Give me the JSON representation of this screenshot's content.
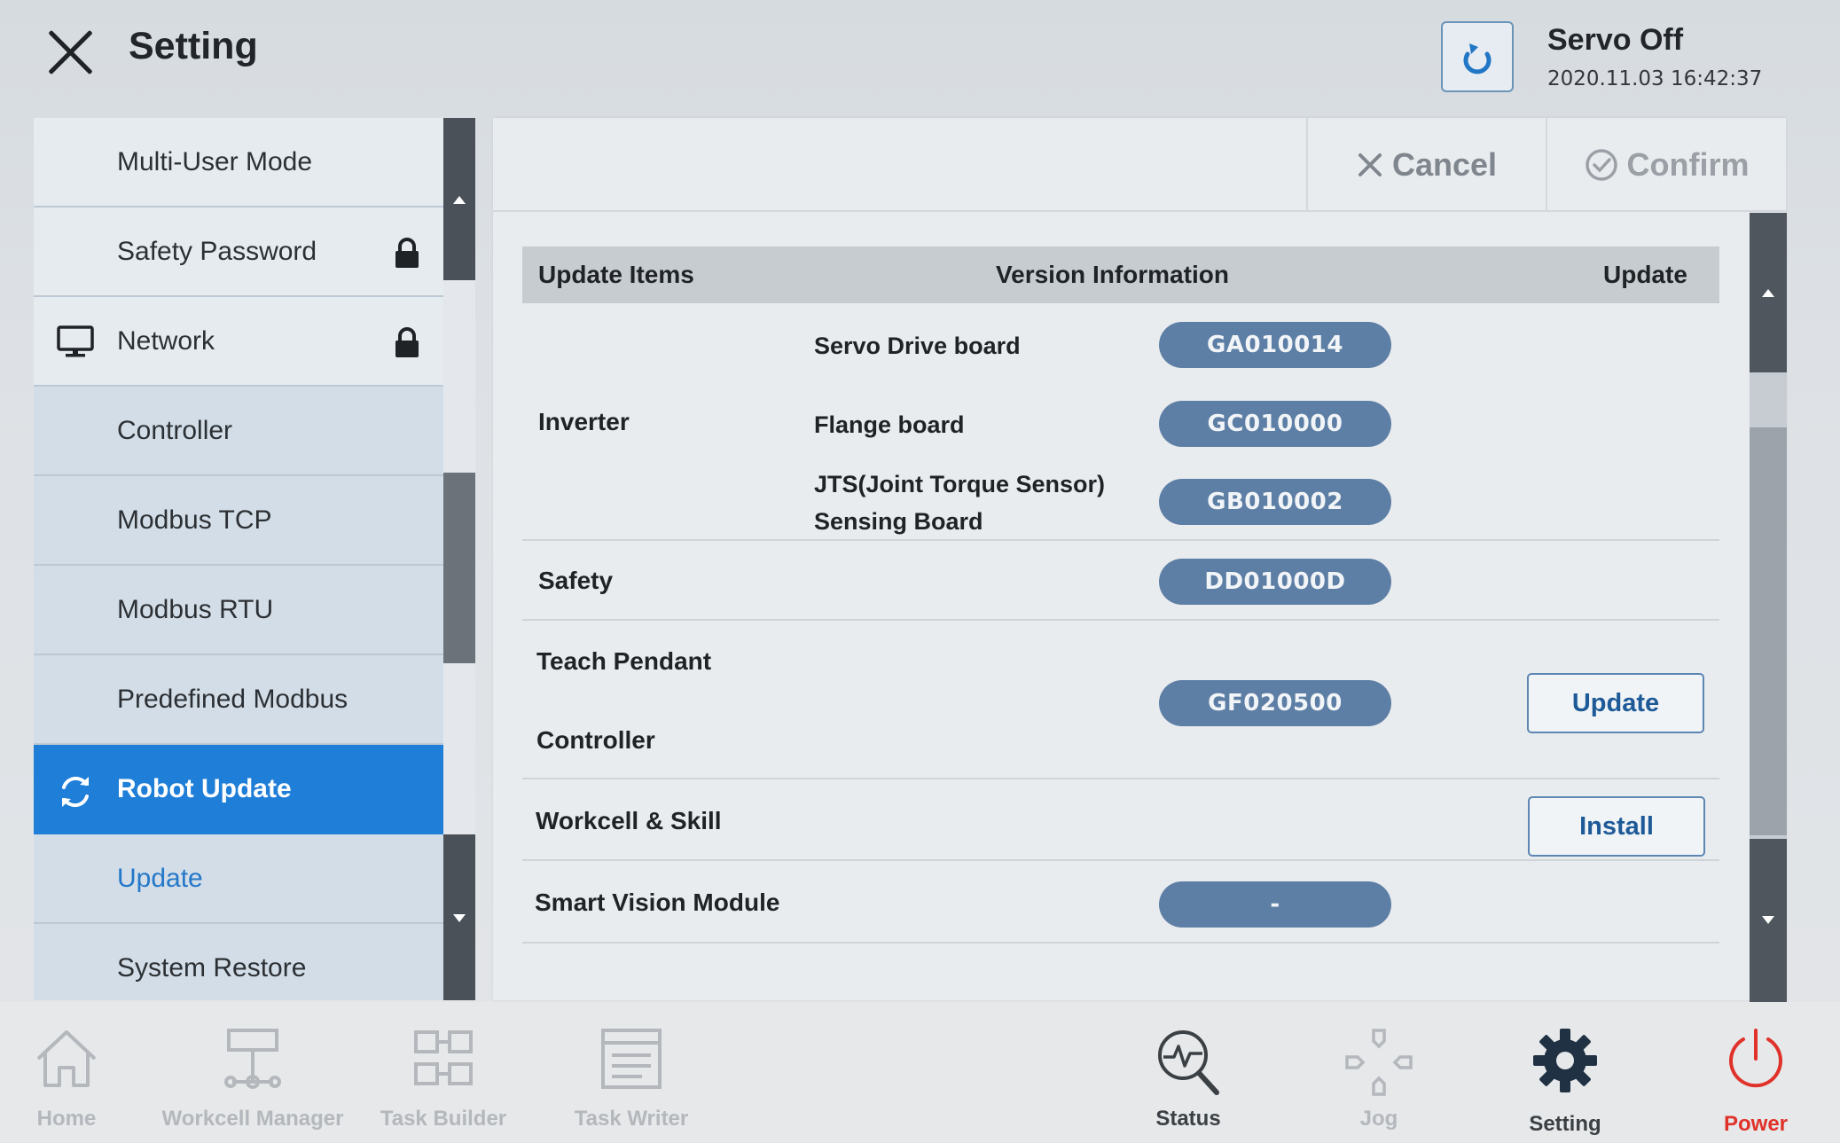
{
  "header": {
    "title": "Setting",
    "servo_state": "Servo Off",
    "datetime": "2020.11.03 16:42:37"
  },
  "sidebar": {
    "items": [
      {
        "label": "Multi-User Mode",
        "locked": false
      },
      {
        "label": "Safety Password",
        "locked": true
      },
      {
        "label": "Network",
        "locked": true,
        "icon": "monitor-icon"
      },
      {
        "label": "Controller"
      },
      {
        "label": "Modbus TCP"
      },
      {
        "label": "Modbus RTU"
      },
      {
        "label": "Predefined Modbus"
      },
      {
        "label": "Robot Update",
        "icon": "sync-icon",
        "active": true
      },
      {
        "label": "Update",
        "selected_sub": true
      },
      {
        "label": "System Restore"
      }
    ]
  },
  "actions": {
    "cancel_label": "Cancel",
    "confirm_label": "Confirm"
  },
  "table": {
    "headers": {
      "items": "Update Items",
      "version": "Version Information",
      "update": "Update"
    },
    "inverter": {
      "label": "Inverter",
      "servo_drive_label": "Servo Drive board",
      "servo_drive_version": "GA010014",
      "flange_label": "Flange board",
      "flange_version": "GC010000",
      "jts_label_line1": "JTS(Joint Torque Sensor)",
      "jts_label_line2": "Sensing Board",
      "jts_version": "GB010002"
    },
    "safety": {
      "label": "Safety",
      "version": "DD01000D"
    },
    "teach_pendant": {
      "label": "Teach Pendant"
    },
    "controller": {
      "label": "Controller",
      "version": "GF020500",
      "button": "Update"
    },
    "workcell": {
      "label": "Workcell & Skill",
      "button": "Install"
    },
    "vision": {
      "label": "Smart Vision Module",
      "version": "-"
    }
  },
  "bottom_nav": {
    "home": "Home",
    "workcell_manager": "Workcell Manager",
    "task_builder": "Task Builder",
    "task_writer": "Task Writer",
    "status": "Status",
    "jog": "Jog",
    "setting": "Setting",
    "power": "Power"
  },
  "colors": {
    "accent": "#1f7fd8",
    "pill": "#5e7fa5",
    "power": "#e0322a"
  }
}
